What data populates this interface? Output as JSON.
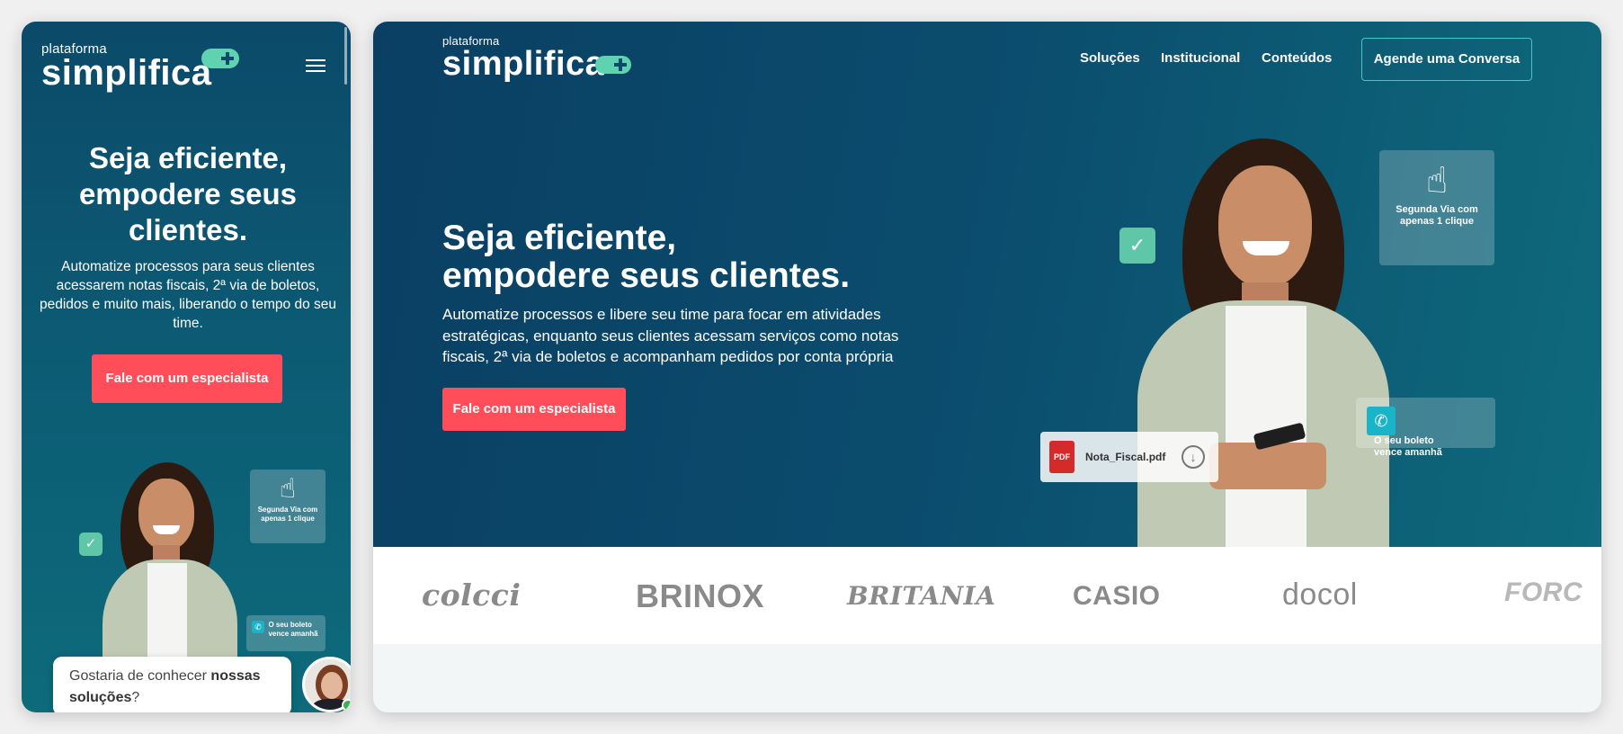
{
  "mobile": {
    "logo": {
      "small": "plataforma",
      "big": "simplifica"
    },
    "hero": {
      "title": "Seja eficiente, empodere seus clientes.",
      "description": "Automatize processos para seus clientes acessarem notas fiscais, 2ª via de boletos, pedidos e muito mais, liberando o tempo do seu time.",
      "cta": "Fale com um especialista"
    },
    "cards": {
      "click": "Segunda Via com apenas 1 clique",
      "boleto": "O seu boleto vence amanhã"
    },
    "chat": {
      "text_prefix": "Gostaria de conhecer ",
      "text_bold": "nossas soluções",
      "text_suffix": "?"
    }
  },
  "desktop": {
    "logo": {
      "small": "plataforma",
      "big": "simplifica"
    },
    "nav": {
      "items": [
        "Soluções",
        "Institucional",
        "Conteúdos"
      ],
      "cta": "Agende uma Conversa"
    },
    "hero": {
      "title_line1": "Seja eficiente,",
      "title_line2": "empodere seus clientes.",
      "description": "Automatize processos e libere seu time para focar em atividades estratégicas, enquanto seus clientes acessam serviços como notas fiscais, 2ª via de boletos e acompanham pedidos por conta própria",
      "cta": "Fale com um especialista"
    },
    "cards": {
      "click": "Segunda Via com apenas 1 clique",
      "boleto": "O seu boleto vence amanhã",
      "pdf_label": "PDF",
      "pdf_name": "Nota_Fiscal.pdf"
    },
    "brands": [
      "colcci",
      "BRINOX",
      "BRITANIA",
      "CASIO",
      "docol",
      "FORC"
    ]
  }
}
